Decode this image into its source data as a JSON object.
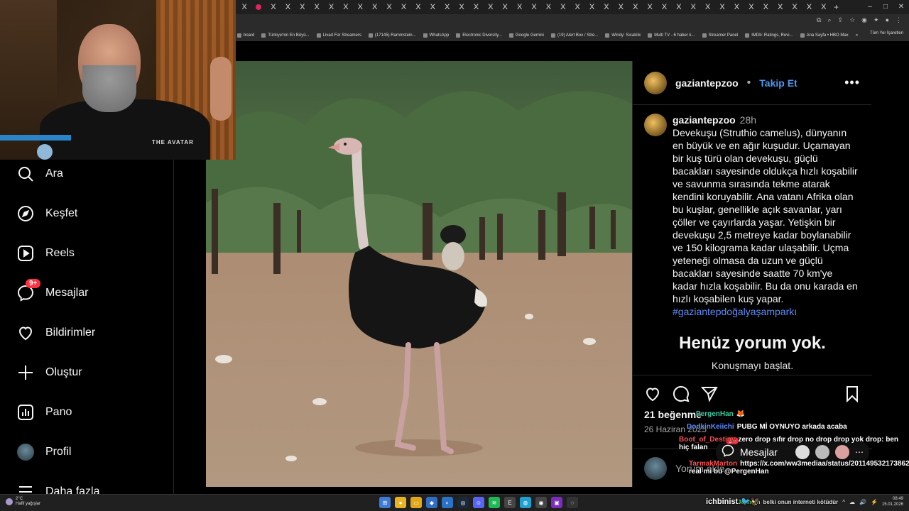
{
  "browser": {
    "tab_close_glyph": "X",
    "tab_count": 41,
    "new_tab": "+",
    "window_controls": [
      "–",
      "□",
      "✕"
    ],
    "bookmarks": [
      "board",
      "Türkiye'nin En Büyü...",
      "Livad For Streamers",
      "(17145) Rammstein...",
      "WhatsApp",
      "Electronic Diversity...",
      "Google Gemini",
      "(19) Alert Box / Stre...",
      "Windy: Sıcaklık",
      "Multi TV - 6 haber k...",
      "Streamer Panel",
      "IMDb: Ratings, Revi...",
      "Ana Sayfa • HBO Max"
    ],
    "bookmarks_more": "»",
    "all_bookmarks": "Tüm Yer İşaretleri"
  },
  "sidebar": {
    "items": [
      {
        "label": "Ara",
        "icon": "search-icon"
      },
      {
        "label": "Keşfet",
        "icon": "compass-icon"
      },
      {
        "label": "Reels",
        "icon": "reels-icon"
      },
      {
        "label": "Mesajlar",
        "icon": "messenger-icon",
        "badge": "9+"
      },
      {
        "label": "Bildirimler",
        "icon": "heart-icon"
      },
      {
        "label": "Oluştur",
        "icon": "plus-icon"
      },
      {
        "label": "Pano",
        "icon": "dashboard-icon"
      },
      {
        "label": "Profil",
        "icon": "avatar"
      },
      {
        "label": "Daha fazla",
        "icon": "menu-icon"
      }
    ]
  },
  "post": {
    "username": "gaziantepzoo",
    "follow_separator": "•",
    "follow_label": "Takip Et",
    "more_glyph": "•••",
    "caption_username": "gaziantepzoo",
    "caption_time": "28h",
    "caption_text": "Devekuşu (Struthio camelus), dünyanın en büyük ve en ağır kuşudur. Uçamayan bir kuş türü olan devekuşu, güçlü bacakları sayesinde oldukça hızlı koşabilir ve savunma sırasında tekme atarak kendini koruyabilir. Ana vatanı Afrika olan bu kuşlar, genellikle açık savanlar, yarı çöller ve çayırlarda yaşar. Yetişkin bir devekuşu 2,5 metreye kadar boylanabilir ve 150 kilograma kadar ulaşabilir. Uçma yeteneği olmasa da uzun ve güçlü bacakları sayesinde saatte 70 km'ye kadar hızla koşabilir. Bu da onu karada en hızlı koşabilen kuş yapar.",
    "hashtag": "#gaziantepdoğalyaşamparkı",
    "no_comments": "Henüz yorum yok.",
    "start_conversation": "Konuşmayı başlat.",
    "likes": "21 beğenme",
    "date": "26 Haziran 2025",
    "comment_placeholder": "Yorum ekle..."
  },
  "stream_overlay": {
    "webcam_logo": "THE AVATAR",
    "messages_label": "Mesajlar",
    "messages_badge": "9+",
    "chat": [
      {
        "user": "PergenHan",
        "color": "#36c9a0",
        "text": "🦊"
      },
      {
        "user": "DodkinKeiichi",
        "color": "#5c8cff",
        "text": "PUBG Mİ OYNUYO arkada acaba"
      },
      {
        "user": "Boot_of_Destiny",
        "color": "#ff4f4f",
        "text": "zero drop sıfır drop no drop drop yok drop: ben hiç falan"
      },
      {
        "user": "TarmakMarton",
        "color": "#ff4f4f",
        "text": "https://x.com/ww3mediaa/status/2011495321738629351? real mi bu @PergenHan"
      },
      {
        "user": "Johnern",
        "color": "#7be07b",
        "text": "belki onun interneti kötüdür"
      },
      {
        "user": "ichbinist",
        "color": "#ffffff",
        "text": "🐦🦅"
      }
    ]
  },
  "taskbar": {
    "temperature": "2°C",
    "weather": "Hafif yağışlar",
    "clock_time": "08:49",
    "clock_date": "15.01.2026",
    "tray_icons": [
      "^",
      "☁",
      "🔊",
      "⚡"
    ]
  },
  "colors": {
    "accent": "#4a9bf4",
    "hashtag": "#5b8cf7",
    "badge": "#ff3040",
    "background": "#000000",
    "border": "#262626"
  }
}
